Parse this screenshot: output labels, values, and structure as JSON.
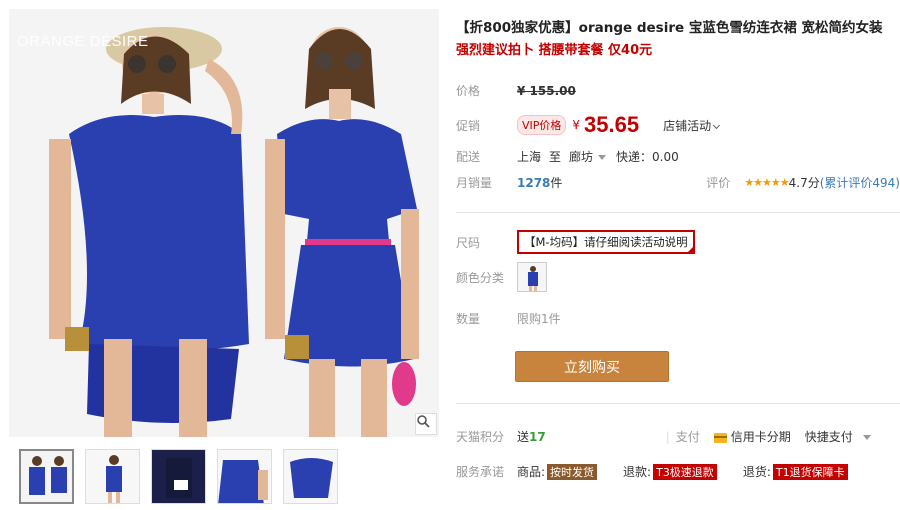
{
  "gallery": {
    "brand_watermark": "ORANGE DÉSIRE",
    "thumbnails": [
      "thumb-1",
      "thumb-2",
      "thumb-3",
      "thumb-4",
      "thumb-5"
    ]
  },
  "product": {
    "title": "【折800独家优惠】orange desire 宝蓝色雪纺连衣裙 宽松简约女装",
    "subtitle": "强烈建议拍卜 搭腰带套餐 仅40元"
  },
  "price": {
    "label": "价格",
    "original": "¥ 155.00"
  },
  "promo_price": {
    "label": "促销",
    "badge": "VIP价格",
    "currency": "¥",
    "value": "35.65",
    "store_promo": "店铺活动"
  },
  "shipping": {
    "label": "配送",
    "from": "上海",
    "to_word": "至",
    "destination": "廊坊",
    "express": "快递：0.00"
  },
  "sales": {
    "label": "月销量",
    "count": "1278",
    "unit": "件",
    "rating_label": "评价",
    "stars": "★★★★★",
    "score": "4.7分",
    "review_count": "(累计评价494)"
  },
  "size": {
    "label": "尺码",
    "value": "【M-均码】请仔细阅读活动说明"
  },
  "color": {
    "label": "颜色分类"
  },
  "quantity": {
    "label": "数量",
    "limit": "限购1件"
  },
  "buy_button": "立刻购买",
  "payment": {
    "points_label": "天猫积分",
    "points_prefix": "送",
    "points_value": "17",
    "pay_label": "支付",
    "credit_card": "信用卡分期",
    "quick_pay": "快捷支付"
  },
  "service": {
    "label": "服务承诺",
    "goods_label": "商品:",
    "goods_tag": "按时发货",
    "refund_label": "退款:",
    "refund_tag": "T3极速退款",
    "return_label": "退货:",
    "return_tag": "T1退货保障卡"
  },
  "colors": {
    "accent": "#c40000",
    "buy_button": "#c8843d",
    "dress_blue": "#2a3fb0"
  }
}
